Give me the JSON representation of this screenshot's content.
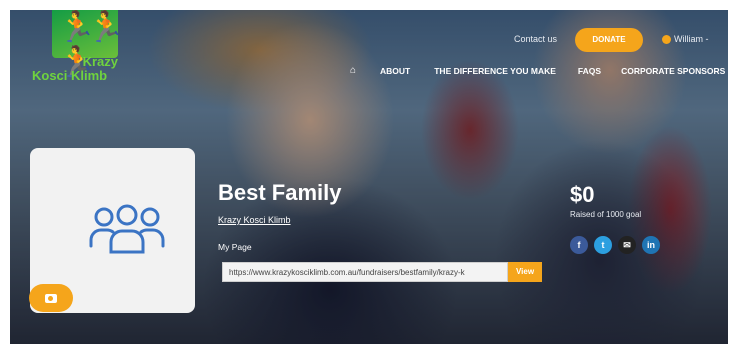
{
  "brand": {
    "logo_line1": "Krazy",
    "logo_line2": "Kosci Klimb",
    "colors": {
      "accent": "#f5a51b",
      "logo_green": "#0f9a45"
    }
  },
  "header": {
    "contact_label": "Contact us",
    "donate_label": "DONATE",
    "user_name": "William -"
  },
  "nav": {
    "home_icon": "home-icon",
    "items": [
      {
        "label": "ABOUT"
      },
      {
        "label": "THE DIFFERENCE YOU MAKE"
      },
      {
        "label": "FAQS"
      },
      {
        "label": "CORPORATE SPONSORS"
      }
    ]
  },
  "profile": {
    "avatar_icon": "group-icon",
    "camera_icon": "camera-icon",
    "title": "Best Family",
    "org_link": "Krazy Kosci Klimb",
    "my_page_label": "My Page",
    "page_url": "https://www.krazykosciklimb.com.au/fundraisers/bestfamily/krazy-k",
    "view_label": "View"
  },
  "fundraising": {
    "amount": "$0",
    "raised_text": "Raised of 1000 goal",
    "social": [
      {
        "name": "facebook-icon",
        "glyph": "f"
      },
      {
        "name": "twitter-icon",
        "glyph": "t"
      },
      {
        "name": "email-icon",
        "glyph": "✉"
      },
      {
        "name": "linkedin-icon",
        "glyph": "in"
      }
    ]
  }
}
